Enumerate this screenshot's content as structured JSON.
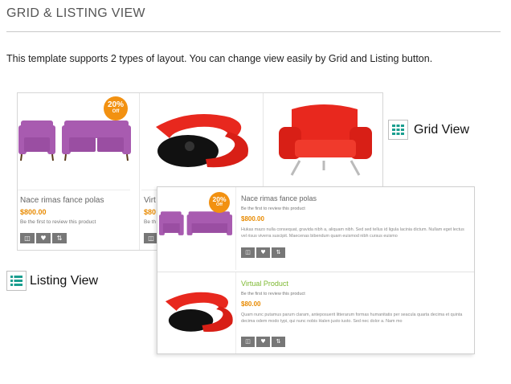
{
  "page": {
    "title": "GRID & LISTING VIEW",
    "intro": "This template supports 2 types of layout. You can change view easily by Grid and Listing button."
  },
  "grid_view": {
    "label": "Grid View",
    "icon": "grid-icon",
    "accent": "#1a9e8f",
    "products": [
      {
        "name": "Nace rimas fance polas",
        "price": "$800.00",
        "review": "Be the first to review this product",
        "badge_pct": "20%",
        "badge_off": "Off"
      },
      {
        "name": "Virt",
        "price": "$80",
        "review": "Be th"
      },
      {
        "name": "",
        "price": "",
        "review": ""
      }
    ]
  },
  "listing_view": {
    "label": "Listing View",
    "icon": "list-icon",
    "accent": "#1a9e8f",
    "products": [
      {
        "name": "Nace rimas fance polas",
        "review": "Be the first to review this product",
        "price": "$800.00",
        "badge_pct": "20%",
        "badge_off": "Off",
        "desc": "Hukas mazo nulla consequat, gravida nibh a, aliquam nibh. Sed sed tellus id ligula lacinia dictum. Nullam eget lectus vel risus viverra suscipit. Maecenas bibendum quam euismod nibh cursus euismo"
      },
      {
        "name": "Virtual Product",
        "review": "Be the first to review this product",
        "price": "$80.00",
        "desc": "Quam nunc putamus parum claram, anteposuerit litterarum formas humanitatis per seacula quarta decima et quinta decima odem modo typi, qui nunc nobis Halen justo iusto. Sed nec dolor a. Nam mo"
      }
    ]
  },
  "actions": {
    "cart_icon": "basket-icon",
    "wishlist_icon": "heart-icon",
    "compare_icon": "compare-icon"
  },
  "colors": {
    "price": "#e88a00",
    "badge": "#f29111",
    "sofa": "#a85bb0",
    "red_product": "#e8281e",
    "action_button": "#777777",
    "virtual_product_name": "#7cb82f"
  }
}
